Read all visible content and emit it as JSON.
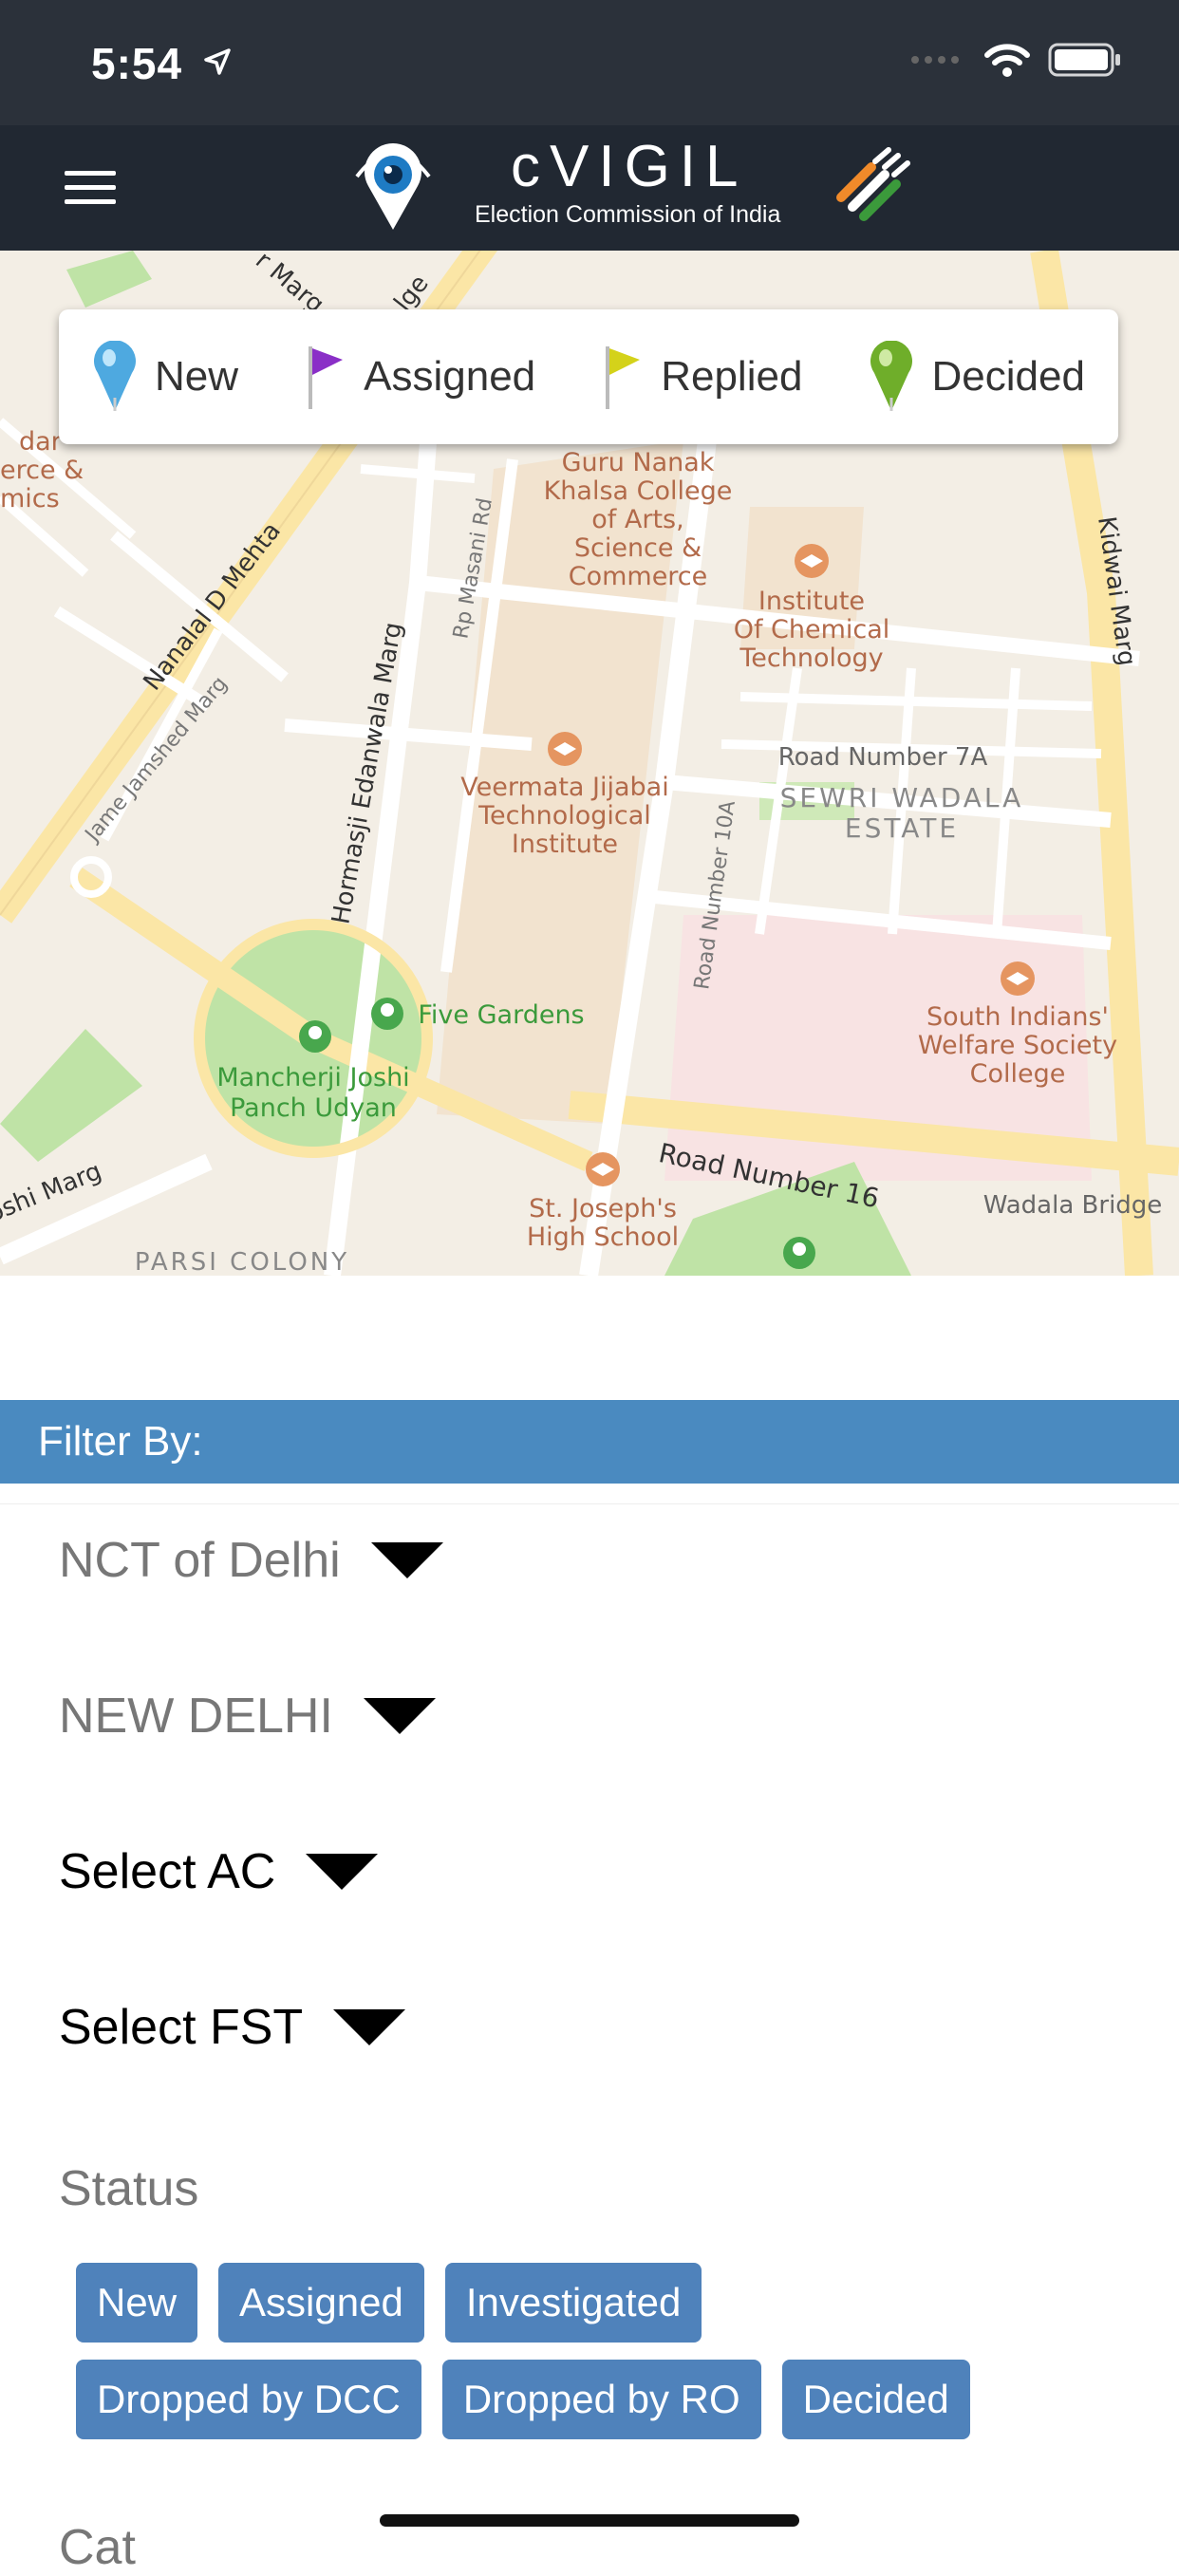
{
  "status_bar": {
    "time": "5:54"
  },
  "app_bar": {
    "title": "cVIGIL",
    "subtitle": "Election Commission of India"
  },
  "legend": [
    {
      "label": "New",
      "color": "#4ea9e0",
      "icon": "blue-pin-icon"
    },
    {
      "label": "Assigned",
      "color": "#8a2fc7",
      "icon": "purple-flag-icon"
    },
    {
      "label": "Replied",
      "color": "#d4d21a",
      "icon": "yellow-flag-icon"
    },
    {
      "label": "Decided",
      "color": "#6fae2a",
      "icon": "green-pin-icon"
    }
  ],
  "map": {
    "labels": {
      "road_sewri": "Sewri Wadala Estate",
      "guru": "Guru Nanak",
      "khalsa": "Khalsa College",
      "of_arts": "of Arts,",
      "science": "Science &",
      "commerce": "Commerce",
      "institute": "Institute",
      "of_chemical": "Of Chemical",
      "technology": "Technology",
      "road7a": "Road Number 7A",
      "sewri1": "SEWRI WADALA",
      "sewri2": "ESTATE",
      "veermata1": "Veermata Jijabai",
      "veermata2": "Technological",
      "veermata3": "Institute",
      "south1": "South Indians'",
      "south2": "Welfare Society",
      "south3": "College",
      "five_gardens": "Five Gardens",
      "mancherji1": "Mancherji Joshi",
      "mancherji2": "Panch Udyan",
      "stjoseph1": "St. Joseph's",
      "stjoseph2": "High School",
      "road16": "Road Number 16",
      "wadala_bridge": "Wadala Bridge",
      "parsi": "PARSI COLONY",
      "nanalal": "Nanalal D Mehta",
      "jamshed": "Jame Jamshed Marg",
      "hormasji": "Hormasji Edanwala Marg",
      "masani": "Rp Masani Rd",
      "road10a": "Road Number 10A",
      "kidwai": "Kidwai Marg",
      "joshi_marg": "oshi Marg",
      "dar": "dar",
      "erce": "erce &",
      "mics": "mics",
      "marg_top": "r Marg",
      "lge": "lge"
    }
  },
  "filter": {
    "header": "Filter By:",
    "state": "NCT of Delhi",
    "district": "NEW DELHI",
    "ac": "Select AC",
    "fst": "Select FST",
    "status_label": "Status",
    "chips_row1": [
      "New",
      "Assigned",
      "Investigated"
    ],
    "chips_row2": [
      "Dropped by DCC",
      "Dropped by RO",
      "Decided"
    ],
    "next_label": "Cat"
  }
}
